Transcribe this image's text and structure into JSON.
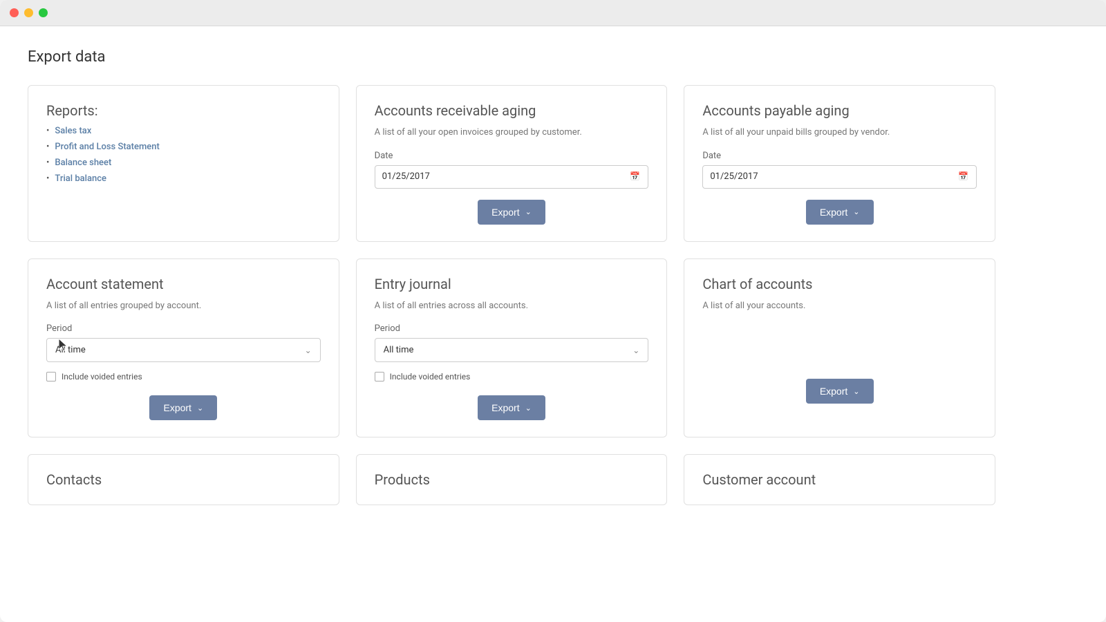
{
  "window": {
    "title": "Export data"
  },
  "page": {
    "title": "Export data"
  },
  "reports_card": {
    "title": "Reports:",
    "links": [
      "Sales tax",
      "Profit and Loss Statement",
      "Balance sheet",
      "Trial balance"
    ]
  },
  "accounts_receivable_card": {
    "title": "Accounts receivable aging",
    "description": "A list of all your open invoices grouped by customer.",
    "date_label": "Date",
    "date_value": "01/25/2017",
    "export_button": "Export"
  },
  "accounts_payable_card": {
    "title": "Accounts payable aging",
    "description": "A list of all your unpaid bills grouped by vendor.",
    "date_label": "Date",
    "date_value": "01/25/2017",
    "export_button": "Export"
  },
  "account_statement_card": {
    "title": "Account statement",
    "description": "A list of all entries grouped by account.",
    "period_label": "Period",
    "period_value": "All time",
    "include_voided_label": "Include voided entries",
    "export_button": "Export"
  },
  "entry_journal_card": {
    "title": "Entry journal",
    "description": "A list of all entries across all accounts.",
    "period_label": "Period",
    "period_value": "All time",
    "include_voided_label": "Include voided entries",
    "export_button": "Export"
  },
  "chart_of_accounts_card": {
    "title": "Chart of accounts",
    "description": "A list of all your accounts.",
    "export_button": "Export"
  },
  "contacts_card": {
    "title": "Contacts"
  },
  "products_card": {
    "title": "Products"
  },
  "customer_account_card": {
    "title": "Customer account"
  }
}
